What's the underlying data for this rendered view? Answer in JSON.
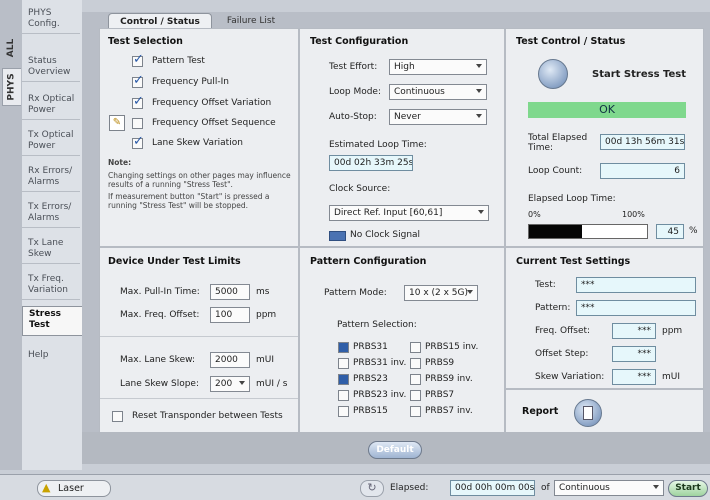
{
  "vertical_tabs": [
    "ALL",
    "PHYS"
  ],
  "sidebar": {
    "items": [
      {
        "label": "PHYS Config."
      },
      {
        "label": "Status Overview"
      },
      {
        "label": "Rx Optical Power"
      },
      {
        "label": "Tx Optical Power"
      },
      {
        "label": "Rx Errors/ Alarms"
      },
      {
        "label": "Tx Errors/ Alarms"
      },
      {
        "label": "Tx Lane Skew"
      },
      {
        "label": "Tx Freq. Variation"
      },
      {
        "label": "Stress Test"
      },
      {
        "label": "Help"
      }
    ]
  },
  "tabs": [
    "Control / Status",
    "Failure List"
  ],
  "test_selection": {
    "title": "Test Selection",
    "items": [
      "Pattern Test",
      "Frequency Pull-In",
      "Frequency Offset Variation",
      "Frequency Offset Sequence",
      "Lane Skew Variation"
    ],
    "checked": [
      true,
      true,
      true,
      false,
      true
    ],
    "note_title": "Note:",
    "note1": "Changing settings on other pages may influence results of a running \"Stress Test\".",
    "note2": "If measurement button \"Start\" is pressed a running \"Stress Test\" will be stopped."
  },
  "test_configuration": {
    "title": "Test Configuration",
    "effort_label": "Test Effort:",
    "effort_value": "High",
    "loop_label": "Loop Mode:",
    "loop_value": "Continuous",
    "autostop_label": "Auto-Stop:",
    "autostop_value": "Never",
    "est_label": "Estimated Loop Time:",
    "est_value": "00d 02h 33m 25s",
    "clock_label": "Clock Source:",
    "clock_value": "Direct Ref. Input [60,61]",
    "no_clock_label": "No Clock Signal"
  },
  "test_control": {
    "title": "Test Control / Status",
    "start_label": "Start Stress Test",
    "status": "OK",
    "total_label": "Total Elapsed Time:",
    "total_value": "00d 13h 56m 31s",
    "loop_count_label": "Loop Count:",
    "loop_count_value": "6",
    "elapsed_loop_label": "Elapsed Loop Time:",
    "pct0": "0%",
    "pct100": "100%",
    "progress": 45,
    "progress_text": "45",
    "pct_unit": "%"
  },
  "dut_limits": {
    "title": "Device Under Test Limits",
    "pullin_label": "Max. Pull-In Time:",
    "pullin_value": "5000",
    "pullin_unit": "ms",
    "offset_label": "Max. Freq. Offset:",
    "offset_value": "100",
    "offset_unit": "ppm",
    "skew_label": "Max. Lane Skew:",
    "skew_value": "2000",
    "skew_unit": "mUI",
    "slope_label": "Lane Skew Slope:",
    "slope_value": "200",
    "slope_unit": "mUI / s",
    "reset_label": "Reset Transponder between Tests"
  },
  "pattern_config": {
    "title": "Pattern Configuration",
    "mode_label": "Pattern Mode:",
    "mode_value": "10 x (2 x 5G)",
    "selection_label": "Pattern Selection:",
    "left": [
      "PRBS31",
      "PRBS31 inv.",
      "PRBS23",
      "PRBS23 inv.",
      "PRBS15"
    ],
    "left_checked": [
      true,
      false,
      true,
      false,
      false
    ],
    "right": [
      "PRBS15 inv.",
      "PRBS9",
      "PRBS9 inv.",
      "PRBS7",
      "PRBS7 inv."
    ]
  },
  "current_settings": {
    "title": "Current Test Settings",
    "test_label": "Test:",
    "test_value": "***",
    "pattern_label": "Pattern:",
    "pattern_value": "***",
    "freq_label": "Freq. Offset:",
    "freq_value": "***",
    "freq_unit": "ppm",
    "step_label": "Offset Step:",
    "step_value": "***",
    "skew_label": "Skew Variation:",
    "skew_value": "***",
    "skew_unit": "mUI"
  },
  "report_label": "Report",
  "default_button": "Default",
  "statusbar": {
    "laser_label": "Laser",
    "elapsed_label": "Elapsed:",
    "elapsed_value": "00d 00h 00m 00s",
    "of_label": "of",
    "of_value": "Continuous",
    "start_label": "Start"
  }
}
